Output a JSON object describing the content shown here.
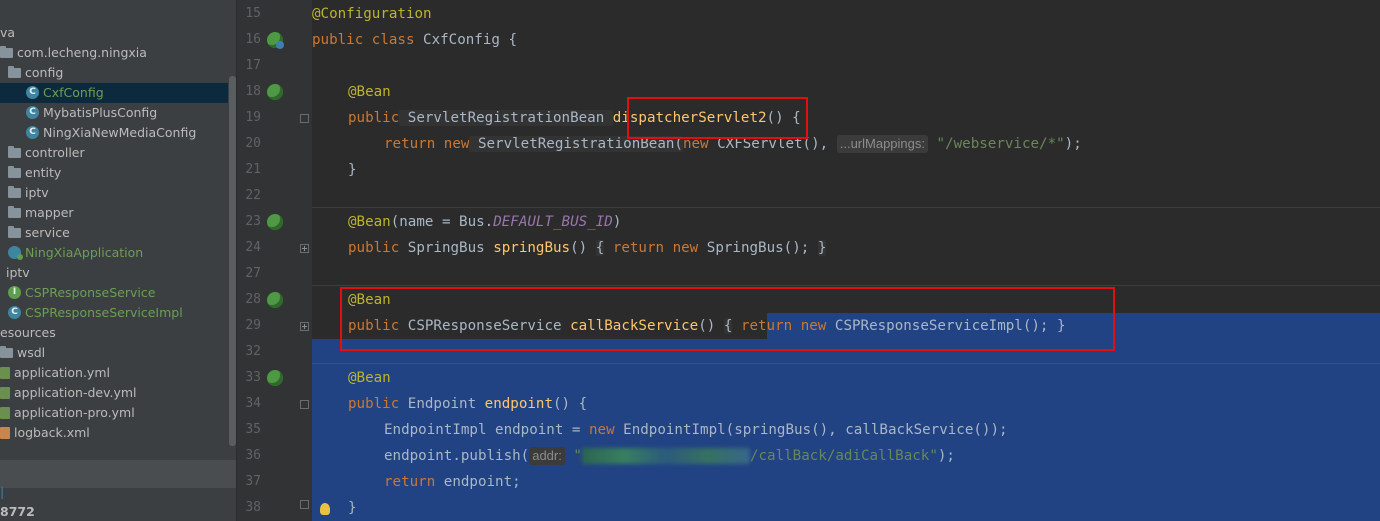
{
  "project_tree": {
    "items": [
      {
        "label": "va",
        "icon": "folder",
        "depth": 0,
        "color": "default"
      },
      {
        "label": "com.lecheng.ningxia",
        "icon": "folder",
        "depth": 0,
        "color": "default"
      },
      {
        "label": "config",
        "icon": "folder",
        "depth": 1,
        "color": "default"
      },
      {
        "label": "CxfConfig",
        "icon": "class",
        "depth": 2,
        "color": "green",
        "selected": true
      },
      {
        "label": "MybatisPlusConfig",
        "icon": "class",
        "depth": 2,
        "color": "default"
      },
      {
        "label": "NingXiaNewMediaConfig",
        "icon": "class",
        "depth": 2,
        "color": "default"
      },
      {
        "label": "controller",
        "icon": "folder",
        "depth": 1,
        "color": "default"
      },
      {
        "label": "entity",
        "icon": "folder",
        "depth": 1,
        "color": "default"
      },
      {
        "label": "iptv",
        "icon": "folder",
        "depth": 1,
        "color": "default"
      },
      {
        "label": "mapper",
        "icon": "folder",
        "depth": 1,
        "color": "default"
      },
      {
        "label": "service",
        "icon": "folder",
        "depth": 1,
        "color": "default"
      },
      {
        "label": "NingXiaApplication",
        "icon": "app",
        "depth": 1,
        "color": "green"
      },
      {
        "label": "iptv",
        "icon": "none",
        "depth": 0,
        "color": "default"
      },
      {
        "label": "CSPResponseService",
        "icon": "interface",
        "depth": 0,
        "color": "green"
      },
      {
        "label": "CSPResponseServiceImpl",
        "icon": "class",
        "depth": 0,
        "color": "green"
      },
      {
        "label": "esources",
        "icon": "none",
        "depth": 0,
        "color": "default"
      },
      {
        "label": "wsdl",
        "icon": "folder",
        "depth": 0,
        "color": "default"
      },
      {
        "label": "application.yml",
        "icon": "yml",
        "depth": 0,
        "color": "default"
      },
      {
        "label": "application-dev.yml",
        "icon": "yml",
        "depth": 0,
        "color": "default"
      },
      {
        "label": "application-pro.yml",
        "icon": "yml",
        "depth": 0,
        "color": "default"
      },
      {
        "label": "logback.xml",
        "icon": "xml",
        "depth": 0,
        "color": "default"
      }
    ],
    "bottom_marker": "|",
    "bottom_number": "8772"
  },
  "editor": {
    "line_numbers": [
      "15",
      "16",
      "17",
      "18",
      "19",
      "20",
      "21",
      "22",
      "23",
      "24",
      "27",
      "28",
      "29",
      "32",
      "33",
      "34",
      "35",
      "36",
      "37",
      "38"
    ],
    "lines": {
      "l15": "@Configuration",
      "l16_kw": "public class",
      "l16_name": " CxfConfig {",
      "l18_ann": "@Bean",
      "l19_kw": "public",
      "l19_type": " ServletRegistrationBean ",
      "l19_fn": "dispatcherServlet2",
      "l19_rest": "() {",
      "l20_kw": "return new",
      "l20_type": " ServletRegistrationBean(",
      "l20_kw2": "new",
      "l20_call": " CXFServlet(),",
      "l20_hint": "...urlMappings:",
      "l20_str": "\"/webservice/*\"",
      "l20_end": ");",
      "l21": "}",
      "l23_ann": "@Bean",
      "l23_args": "(name = Bus.",
      "l23_const": "DEFAULT_BUS_ID",
      "l23_end": ")",
      "l24_kw": "public",
      "l24_type": " SpringBus ",
      "l24_fn": "springBus",
      "l24_paren": "() ",
      "l24_open": "{",
      "l24_kw2": "return new",
      "l24_call": " SpringBus();",
      "l24_close": "}",
      "l28_ann": "@Bean",
      "l29_kw": "public",
      "l29_type": " CSPResponseService ",
      "l29_fn": "callBackService",
      "l29_paren": "() ",
      "l29_open": "{",
      "l29_kw2": "return new",
      "l29_call": " CSPResponseServiceImpl();",
      "l29_close": "}",
      "l33_ann": "@Bean",
      "l34_kw": "public",
      "l34_type": " Endpoint ",
      "l34_fn": "endpoint",
      "l34_rest": "() {",
      "l35_a": "EndpointImpl endpoint = ",
      "l35_kw": "new",
      "l35_b": " EndpointImpl(springBus(), callBackService());",
      "l36_a": "endpoint.publish(",
      "l36_hint": "addr:",
      "l36_str": "/callBack/adiCallBack\"",
      "l36_end": ");",
      "l37_kw": "return",
      "l37_b": " endpoint;",
      "l38": "}"
    }
  },
  "colors": {
    "keyword": "#cc7832",
    "annotation": "#bbb529",
    "method": "#ffc66d",
    "string": "#6a8759",
    "selection": "#214283",
    "highlight_box": "#e01010"
  }
}
